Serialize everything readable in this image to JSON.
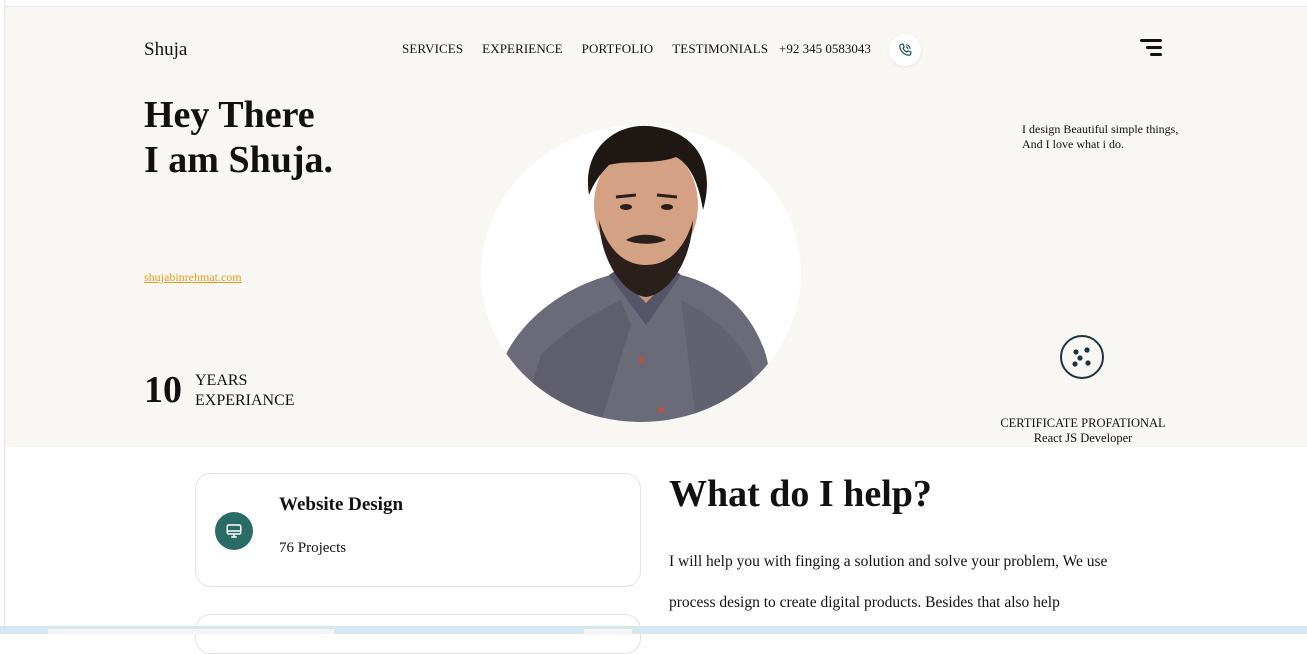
{
  "header": {
    "logo": "Shuja",
    "nav": [
      "SERVICES",
      "EXPERIENCE",
      "PORTFOLIO",
      "TESTIMONIALS"
    ],
    "phone": "+92 345 0583043",
    "phone_icon": "phone-icon",
    "menu_icon": "hamburger-menu-icon"
  },
  "hero": {
    "title_line1": "Hey There",
    "title_line2": "I am Shuja.",
    "website": "shujabinrehmat.com",
    "years_number": "10",
    "years_label_1": "YEARS",
    "years_label_2": "EXPERIANCE",
    "tagline": "I design Beautiful simple things, And I love what i do.",
    "certificate_title": "CERTIFICATE PROFATIONAL",
    "certificate_subtitle": "React JS Developer"
  },
  "services": [
    {
      "title": "Website Design",
      "count": "76 Projects",
      "icon": "monitor-icon"
    }
  ],
  "help": {
    "title": "What do I help?",
    "text": "I will help you with finging a solution and solve your problem, We use process design to create digital products. Besides that also help"
  },
  "colors": {
    "hero_bg": "#f8f7f3",
    "accent_link": "#e89b1a",
    "service_icon_bg": "#2a6b66",
    "dark": "#1d3440"
  }
}
